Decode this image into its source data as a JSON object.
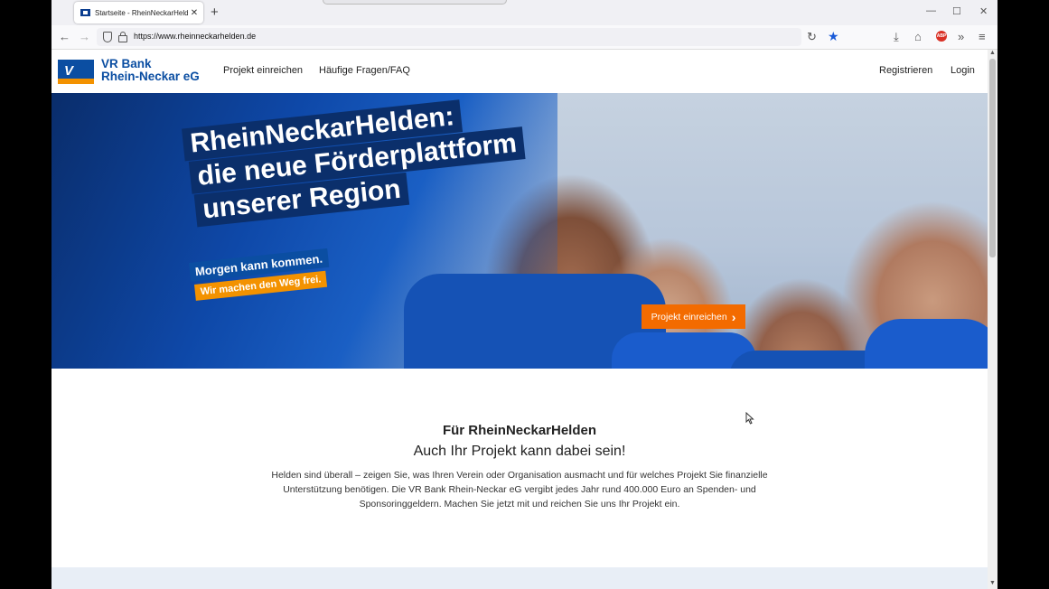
{
  "browser": {
    "tab_title": "Startseite - RheinNeckarHelden",
    "tab_close": "✕",
    "new_tab": "+",
    "url": "https://www.rheinneckarhelden.de",
    "window_controls": [
      "—",
      "☐",
      "✕"
    ],
    "back": "←",
    "forward": "→",
    "reload": "↻",
    "bookmark_star": "★",
    "download": "⤓",
    "home": "⌂",
    "abp_badge": "ABP",
    "overflow": "»",
    "menu": "≡"
  },
  "site": {
    "brand_line1": "VR Bank",
    "brand_line2": "Rhein-Neckar eG",
    "logo_glyph": "V",
    "nav": {
      "projekt": "Projekt einreichen",
      "faq": "Häufige Fragen/FAQ",
      "register": "Registrieren",
      "login": "Login"
    }
  },
  "hero": {
    "headline_1": "RheinNeckarHelden:",
    "headline_2": "die neue Förderplattform",
    "headline_3": "unserer Region",
    "slogan_1": "Morgen kann kommen.",
    "slogan_2": "Wir machen den Weg frei.",
    "cta_label": "Projekt einreichen",
    "cta_icon": "›"
  },
  "section": {
    "title": "Für RheinNeckarHelden",
    "subtitle": "Auch Ihr Projekt kann dabei sein!",
    "paragraph": "Helden sind überall – zeigen Sie, was Ihren Verein oder Organisation ausmacht und für welches Projekt Sie finanzielle Unterstützung benötigen. Die VR Bank Rhein-Neckar eG vergibt jedes Jahr rund 400.000 Euro an Spenden- und Sponsoringgeldern. Machen Sie jetzt mit und reichen Sie uns Ihr Projekt ein."
  },
  "colors": {
    "brand_blue": "#0b4ea2",
    "brand_orange": "#f39200",
    "cta_orange": "#f36b00",
    "headline_bg": "#0b2f6b"
  }
}
